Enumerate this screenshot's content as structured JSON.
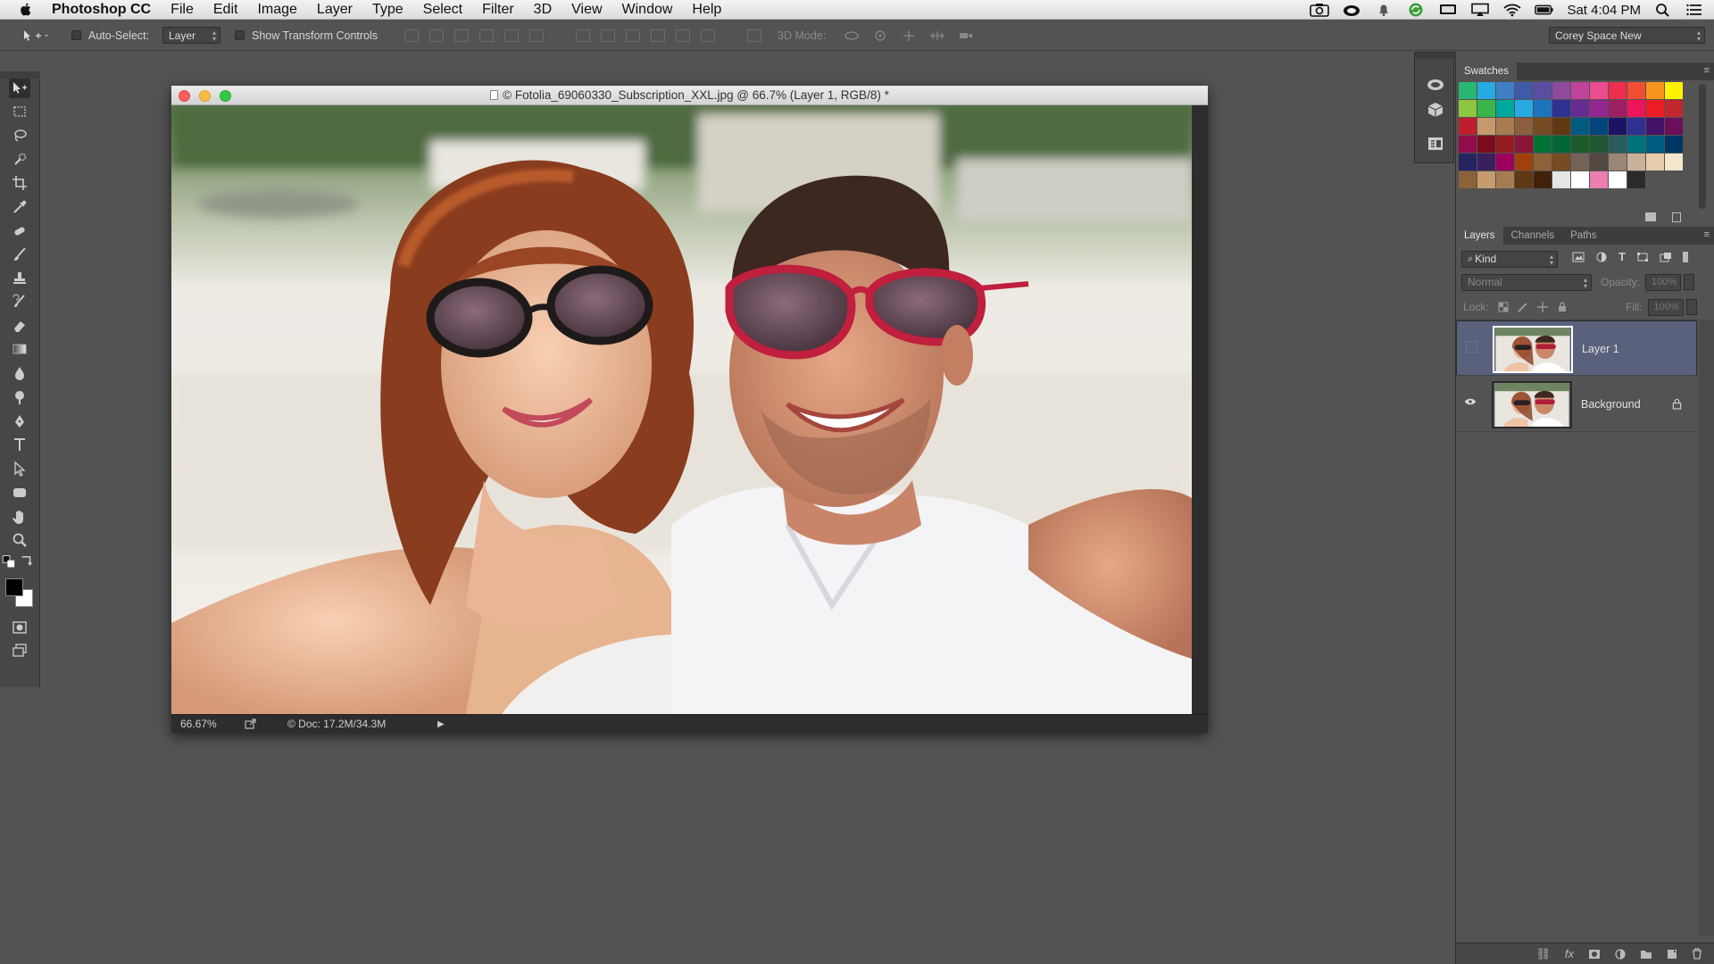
{
  "menubar": {
    "app_name": "Photoshop CC",
    "items": [
      "File",
      "Edit",
      "Image",
      "Layer",
      "Type",
      "Select",
      "Filter",
      "3D",
      "View",
      "Window",
      "Help"
    ],
    "clock": "Sat 4:04 PM"
  },
  "options": {
    "auto_select_label": "Auto-Select:",
    "auto_select_value": "Layer",
    "transform_label": "Show Transform Controls",
    "mode_3d_label": "3D Mode:",
    "workspace": "Corey Space New"
  },
  "document": {
    "title": "© Fotolia_69060330_Subscription_XXL.jpg @ 66.7% (Layer 1, RGB/8) *",
    "zoom": "66.67%",
    "doc_size": "© Doc: 17.2M/34.3M"
  },
  "swatches": {
    "tab": "Swatches",
    "colors": [
      "#2bb673",
      "#27aae1",
      "#3f7fc4",
      "#3e5aa8",
      "#5b4ea2",
      "#8e4a9e",
      "#c0449b",
      "#ea4e8f",
      "#ee2e4e",
      "#ef5033",
      "#f7941d",
      "#fff200",
      "#8dc63f",
      "#39b54a",
      "#00a79d",
      "#27aae1",
      "#1c75bc",
      "#2e3192",
      "#662d91",
      "#92278f",
      "#9e1f63",
      "#ed145b",
      "#ed1c24",
      "#c1272d",
      "#be1e2d",
      "#c49a6c",
      "#a97c50",
      "#8b5e3c",
      "#754c24",
      "#603913",
      "#005b7f",
      "#00457c",
      "#1b1464",
      "#2e3192",
      "#44146a",
      "#6b0f5a",
      "#8f0d4b",
      "#7b0c1d",
      "#941d20",
      "#8a1538",
      "#007236",
      "#006838",
      "#1c5a2a",
      "#215732",
      "#2a5c5c",
      "#00737a",
      "#005d7f",
      "#003663",
      "#252361",
      "#3a1f5d",
      "#9e005d",
      "#a0410d",
      "#8c6239",
      "#754c24",
      "#736357",
      "#534741",
      "#998675",
      "#c7b299",
      "#e6ceac",
      "#f5e6cc",
      "#8c6239",
      "#c69c6d",
      "#a67c52",
      "#603813",
      "#42210b",
      "#e5e5e5",
      "#ffffff",
      "#ea7fb0",
      "#ffffff",
      "#2b2b2b"
    ]
  },
  "layers_panel": {
    "tabs": [
      "Layers",
      "Channels",
      "Paths"
    ],
    "kind": "Kind",
    "blend_mode": "Normal",
    "opacity_label": "Opacity:",
    "opacity_value": "100%",
    "lock_label": "Lock:",
    "fill_label": "Fill:",
    "fill_value": "100%",
    "layers": [
      {
        "name": "Layer 1",
        "visible": false,
        "selected": true
      },
      {
        "name": "Background",
        "visible": true,
        "locked": true
      }
    ]
  },
  "icons": {
    "toolbar": [
      "move-icon",
      "marquee-icon",
      "lasso-icon",
      "quick-select-icon",
      "crop-icon",
      "eyedropper-icon",
      "spot-heal-icon",
      "brush-icon",
      "stamp-icon",
      "history-brush-icon",
      "eraser-icon",
      "gradient-icon",
      "blur-icon",
      "dodge-icon",
      "pen-icon",
      "type-icon",
      "path-select-icon",
      "shape-icon",
      "hand-icon",
      "zoom-icon"
    ]
  }
}
